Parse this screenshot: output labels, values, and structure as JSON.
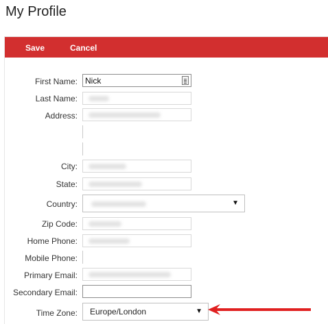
{
  "page": {
    "title": "My Profile"
  },
  "toolbar": {
    "save_label": "Save",
    "cancel_label": "Cancel"
  },
  "form": {
    "first_name": {
      "label": "First Name:",
      "value": "Nick"
    },
    "last_name": {
      "label": "Last Name:"
    },
    "address": {
      "label": "Address:"
    },
    "city": {
      "label": "City:"
    },
    "state": {
      "label": "State:"
    },
    "country": {
      "label": "Country:"
    },
    "zip_code": {
      "label": "Zip Code:"
    },
    "home_phone": {
      "label": "Home Phone:"
    },
    "mobile_phone": {
      "label": "Mobile Phone:"
    },
    "primary_email": {
      "label": "Primary Email:"
    },
    "secondary_email": {
      "label": "Secondary Email:"
    },
    "time_zone": {
      "label": "Time Zone:",
      "value": "Europe/London"
    }
  },
  "colors": {
    "toolbar": "#d22f2f",
    "arrow": "#e02020"
  },
  "icons": {
    "caret": "▼"
  }
}
